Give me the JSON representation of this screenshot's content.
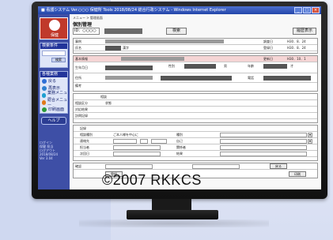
{
  "window": {
    "title": "■ 看護システム Ver.○○○ 保健所 Tools 2018/08/24 総合行政システム - Windows Internet Explorer",
    "min": "_",
    "max": "□",
    "close": "×"
  },
  "sidebar": {
    "logo_label": "保健",
    "search_head": "検索条件",
    "search_button": "検索",
    "menu_head": "各種業務",
    "menu_items": [
      {
        "label": "戻る",
        "color": "#2f6fd6"
      },
      {
        "label": "再表示",
        "color": "#2e7fd0"
      },
      {
        "label": "業務メニュー",
        "color": "#1e9fd0"
      },
      {
        "label": "総合メニュー",
        "color": "#e07a1b"
      },
      {
        "label": "印刷画面",
        "color": "#2a9a3a"
      }
    ],
    "help_label": "ヘルプ",
    "footer_lines": [
      "ログイン",
      "保健 担当",
      "ログアウト",
      "2018/08/24",
      "Ver 3.04"
    ]
  },
  "main": {
    "breadcrumb": "メニュー > 管理画面",
    "page_title": "個別管理",
    "id_value": "ID：○○○○",
    "search_button": "検索",
    "history_button": "履歴表示",
    "labels": {
      "case": "事例",
      "name_label": "氏名",
      "name_kana": "漢字",
      "basic_info": "基本情報",
      "stat1": "調査日",
      "stat2": "登録日",
      "stat3": "更新日",
      "stat1_val": "H30．8．24",
      "stat2_val": "H30．8．24",
      "stat3_val": "H30．10．1",
      "person_block": "基本情報",
      "dob": "生年月日",
      "gender": "性別",
      "gender_val": "男",
      "addr": "住所",
      "tel": "電話",
      "age": "年齢",
      "age_val": "才",
      "family": "家族",
      "status": "状態",
      "note": "備考",
      "consult": "相談",
      "reason_label": "相談区分",
      "result_label": "対応結果",
      "visit_label": "訪問記録",
      "type": "相談種別",
      "type_val": "ご本人様を中心に",
      "contact": "連絡先",
      "worker": "担当者",
      "kind": "種別",
      "self": "自己",
      "other": "関係者",
      "date": "次回日",
      "outcome": "結果",
      "remark": "記録",
      "check": "確認",
      "save": "登録",
      "back": "戻る",
      "print": "印刷"
    }
  },
  "copyright": "©2007  RKKCS"
}
